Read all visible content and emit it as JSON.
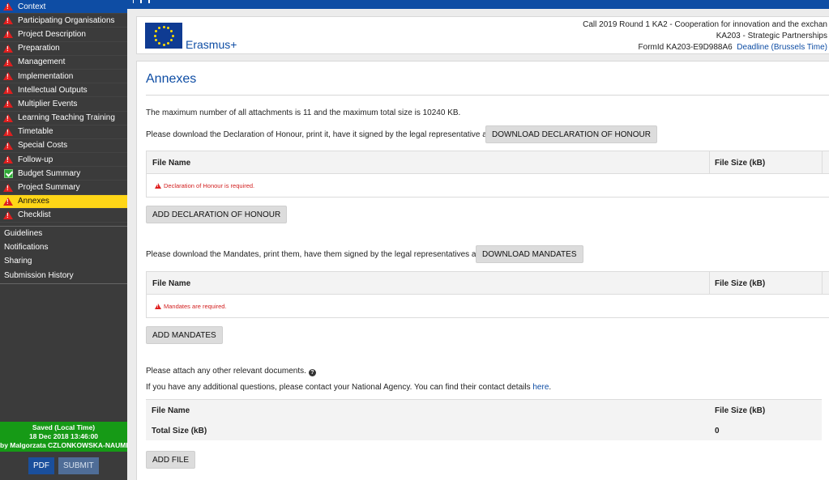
{
  "sidebar": {
    "items": [
      {
        "label": "Context",
        "status": "warning",
        "state": "active-blue"
      },
      {
        "label": "Participating Organisations",
        "status": "warning"
      },
      {
        "label": "Project Description",
        "status": "warning"
      },
      {
        "label": "Preparation",
        "status": "warning"
      },
      {
        "label": "Management",
        "status": "warning"
      },
      {
        "label": "Implementation",
        "status": "warning"
      },
      {
        "label": "Intellectual Outputs",
        "status": "warning"
      },
      {
        "label": "Multiplier Events",
        "status": "warning"
      },
      {
        "label": "Learning Teaching Training",
        "status": "warning"
      },
      {
        "label": "Timetable",
        "status": "warning"
      },
      {
        "label": "Special Costs",
        "status": "warning"
      },
      {
        "label": "Follow-up",
        "status": "warning"
      },
      {
        "label": "Budget Summary",
        "status": "ok"
      },
      {
        "label": "Project Summary",
        "status": "warning"
      },
      {
        "label": "Annexes",
        "status": "warning",
        "state": "active-yellow"
      },
      {
        "label": "Checklist",
        "status": "warning"
      }
    ],
    "links": [
      "Guidelines",
      "Notifications",
      "Sharing",
      "Submission History"
    ],
    "save": {
      "line1": "Saved (Local Time)",
      "line2": "18 Dec 2018 13:46:00",
      "line3": "by Malgorzata CZLONKOWSKA-NAUMIU"
    },
    "pdf_label": "PDF",
    "submit_label": "SUBMIT"
  },
  "header": {
    "brand": "Erasmus+",
    "line1": "Call 2019   Round 1   KA2 - Cooperation for innovation and the exchan",
    "line2": "KA203 - Strategic Partnerships",
    "formid": "FormId KA203-E9D988A6",
    "deadline": "Deadline (Brussels Time)"
  },
  "main": {
    "title": "Annexes",
    "limits_text": "The maximum number of all attachments is 11 and the maximum total size is 10240 KB.",
    "declaration": {
      "instruction": "Please download the Declaration of Honour, print it, have it signed by the legal representative and attach.",
      "download_label": "DOWNLOAD DECLARATION OF HONOUR",
      "col_name": "File Name",
      "col_size": "File Size (kB)",
      "error": "Declaration of Honour is required.",
      "add_label": "ADD DECLARATION OF HONOUR"
    },
    "mandates": {
      "instruction": "Please download the Mandates, print them, have them signed by the legal representatives and attach.",
      "download_label": "DOWNLOAD MANDATES",
      "col_name": "File Name",
      "col_size": "File Size (kB)",
      "error": "Mandates are required.",
      "add_label": "ADD MANDATES"
    },
    "other": {
      "instruction": "Please attach any other relevant documents.",
      "contact_text": "If you have any additional questions, please contact your National Agency. You can find their contact details ",
      "contact_link": "here",
      "contact_end": ".",
      "col_name": "File Name",
      "col_size": "File Size (kB)",
      "total_label": "Total Size (kB)",
      "total_value": "0",
      "add_label": "ADD FILE"
    }
  },
  "colors": {
    "primary_blue": "#0e4da4",
    "active_yellow": "#ffd617",
    "save_green": "#169a16",
    "error_red": "#d21e1e"
  }
}
